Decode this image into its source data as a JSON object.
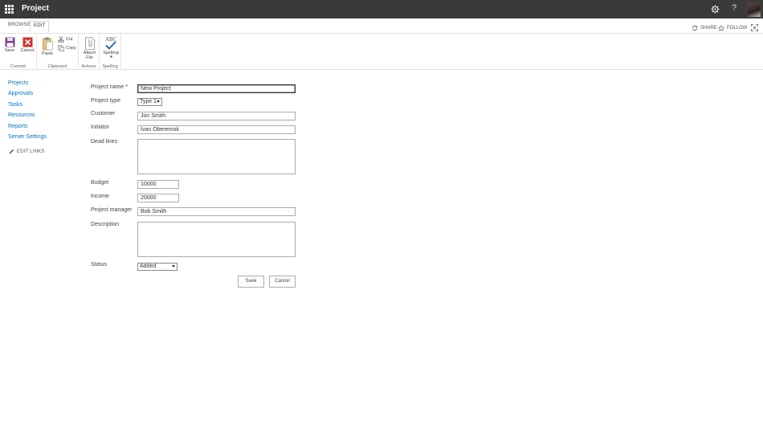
{
  "suite": {
    "title": "Project",
    "help_glyph": "?",
    "icons": [
      "app-launcher-icon",
      "gear-icon",
      "help-icon",
      "avatar"
    ]
  },
  "tabs": [
    {
      "label": "BROWSE",
      "active": false
    },
    {
      "label": "EDIT",
      "active": true
    }
  ],
  "actions": {
    "share": "SHARE",
    "follow": "FOLLOW"
  },
  "ribbon": {
    "commit": {
      "label": "Commit",
      "save": "Save",
      "cancel": "Cancel"
    },
    "clipboard": {
      "label": "Clipboard",
      "paste": "Paste",
      "cut": "Cut",
      "copy": "Copy"
    },
    "actions": {
      "label": "Actions",
      "attach_line1": "Attach",
      "attach_line2": "File"
    },
    "spelling": {
      "label": "Spelling",
      "button": "Spelling",
      "icon_text": "ABC"
    }
  },
  "nav": {
    "items": [
      "Projects",
      "Approvals",
      "Tasks",
      "Resources",
      "Reports",
      "Server Settings"
    ],
    "edit_links": "EDIT LINKS"
  },
  "form": {
    "project_name": {
      "label": "Project name",
      "required": "*",
      "value": "New Project"
    },
    "project_type": {
      "label": "Project type",
      "value": "Type 1"
    },
    "customer": {
      "label": "Customer",
      "value": "Jon Smith"
    },
    "initiator": {
      "label": "Initiator",
      "value": "Ivan Oberemok"
    },
    "dead_lines": {
      "label": "Dead lines",
      "value": ""
    },
    "budget": {
      "label": "Budget",
      "value": "10000"
    },
    "income": {
      "label": "Income",
      "value": "20000"
    },
    "project_manager": {
      "label": "Project manager",
      "value": "Bob Smith"
    },
    "description": {
      "label": "Description",
      "value": ""
    },
    "status": {
      "label": "Status",
      "value": "Added"
    },
    "save": "Save",
    "cancel": "Cancel"
  },
  "colors": {
    "suite_bar": "#3a3a3a",
    "link": "#0072c6",
    "save_icon": "#7a3f8f",
    "cancel_icon": "#d0312d",
    "required": "#bf0000"
  }
}
